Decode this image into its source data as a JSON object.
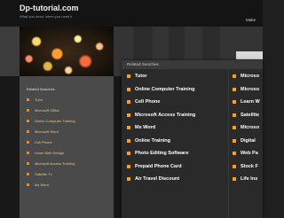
{
  "header": {
    "site_title": "Dp-tutorial.com",
    "tagline": "What you need, when you need it",
    "make_link": "Make"
  },
  "sidebar": {
    "title": "Related Searches",
    "items": [
      "Tutor",
      "Microsoft Office",
      "Online Computer Training",
      "Microsoft Word",
      "Cell Phone",
      "Learn Web Design",
      "Microsoft Access Training",
      "Satellite Tv",
      "Ms Word"
    ]
  },
  "popup": {
    "title": "Related Searches",
    "left_items": [
      "Tutor",
      "Online Computer Training",
      "Cell Phone",
      "Microsoft Access Training",
      "Ms Word",
      "Online Training",
      "Photo Editing Software",
      "Prepaid Phone Card",
      "Air Travel Discount"
    ],
    "right_items": [
      "Microso",
      "Microso",
      "Learn W",
      "Satellite",
      "Microso",
      "Digital",
      "Web Pa",
      "Stock F",
      "Life Ins"
    ]
  },
  "colors": {
    "accent": "#ff9d1d",
    "sidebar_link": "#e9c889"
  }
}
